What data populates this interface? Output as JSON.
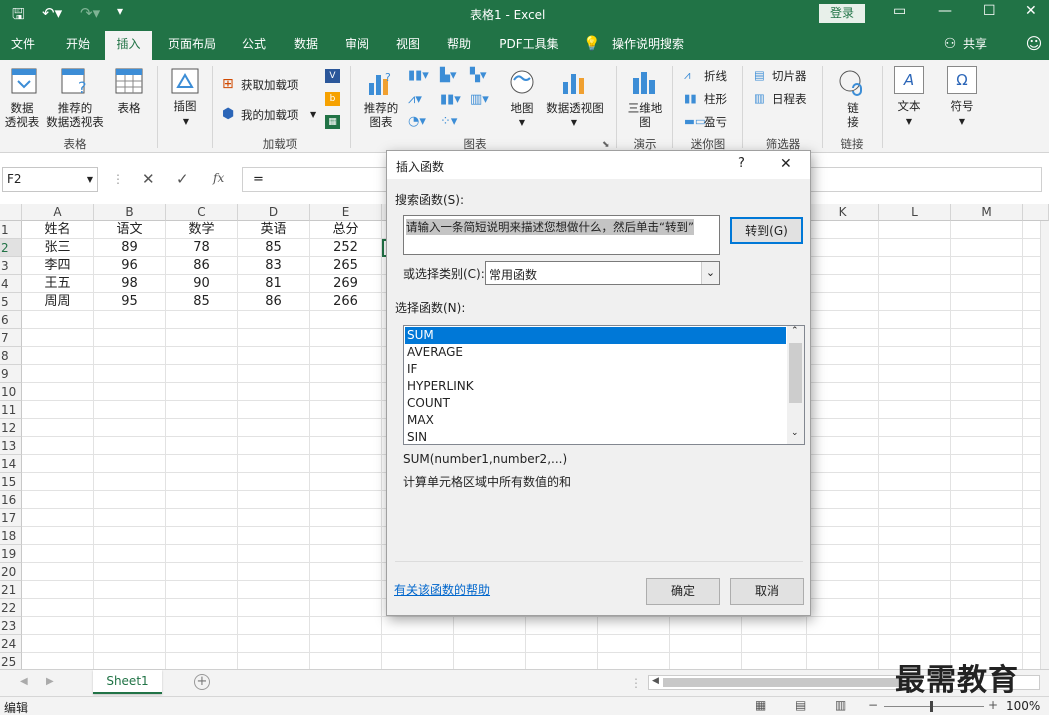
{
  "window": {
    "title": "表格1 - Excel",
    "login": "登录",
    "min": "—",
    "max": "☐",
    "close": "✕"
  },
  "tabs": [
    "文件",
    "开始",
    "插入",
    "页面布局",
    "公式",
    "数据",
    "审阅",
    "视图",
    "帮助",
    "PDF工具集",
    "操作说明搜索"
  ],
  "active_tab": "插入",
  "share": "共享",
  "ribbon": {
    "pivot_label_1": "数据",
    "pivot_label_2": "透视表",
    "rec_pivot_1": "推荐的",
    "rec_pivot_2": "数据透视表",
    "table": "表格",
    "group_tables": "表格",
    "illustrations": "插图",
    "get_addins": "获取加载项",
    "my_addins": "我的加载项",
    "group_addins": "加载项",
    "rec_chart_1": "推荐的",
    "rec_chart_2": "图表",
    "map": "地图",
    "pivot_chart": "数据透视图",
    "group_charts": "图表",
    "map3d_1": "三维地",
    "map3d_2": "图",
    "group_tours": "演示",
    "spark_line": "折线",
    "spark_col": "柱形",
    "spark_wl": "盈亏",
    "group_sparklines": "迷你图",
    "slicer": "切片器",
    "timeline": "日程表",
    "group_filters": "筛选器",
    "link_1": "链",
    "link_2": "接",
    "group_links": "链接",
    "text": "文本",
    "symbol": "符号"
  },
  "formula_bar": {
    "name_box": "F2",
    "fx": "fx",
    "formula": "="
  },
  "sheet": {
    "columns": [
      "A",
      "B",
      "C",
      "D",
      "E",
      "K",
      "L",
      "M"
    ],
    "rows": [
      "1",
      "2",
      "3",
      "4",
      "5",
      "6",
      "7",
      "8",
      "9",
      "10",
      "11",
      "12",
      "13",
      "14",
      "15",
      "16",
      "17",
      "18",
      "19",
      "20",
      "21",
      "22",
      "23",
      "24",
      "25"
    ],
    "data": [
      [
        "姓名",
        "语文",
        "数学",
        "英语",
        "总分"
      ],
      [
        "张三",
        "89",
        "78",
        "85",
        "252"
      ],
      [
        "李四",
        "96",
        "86",
        "83",
        "265"
      ],
      [
        "王五",
        "98",
        "90",
        "81",
        "269"
      ],
      [
        "周周",
        "95",
        "85",
        "86",
        "266"
      ]
    ],
    "tab": "Sheet1"
  },
  "status": {
    "mode": "编辑",
    "zoom": "100%"
  },
  "dialog": {
    "title": "插入函数",
    "help": "?",
    "close": "✕",
    "search_label": "搜索函数(S):",
    "search_value": "请输入一条简短说明来描述您想做什么，然后单击“转到”",
    "goto": "转到(G)",
    "category_label": "或选择类别(C):",
    "category_value": "常用函数",
    "select_label": "选择函数(N):",
    "functions": [
      "SUM",
      "AVERAGE",
      "IF",
      "HYPERLINK",
      "COUNT",
      "MAX",
      "SIN"
    ],
    "signature": "SUM(number1,number2,...)",
    "description": "计算单元格区域中所有数值的和",
    "help_link": "有关该函数的帮助",
    "ok": "确定",
    "cancel": "取消"
  },
  "watermark": "最需教育"
}
